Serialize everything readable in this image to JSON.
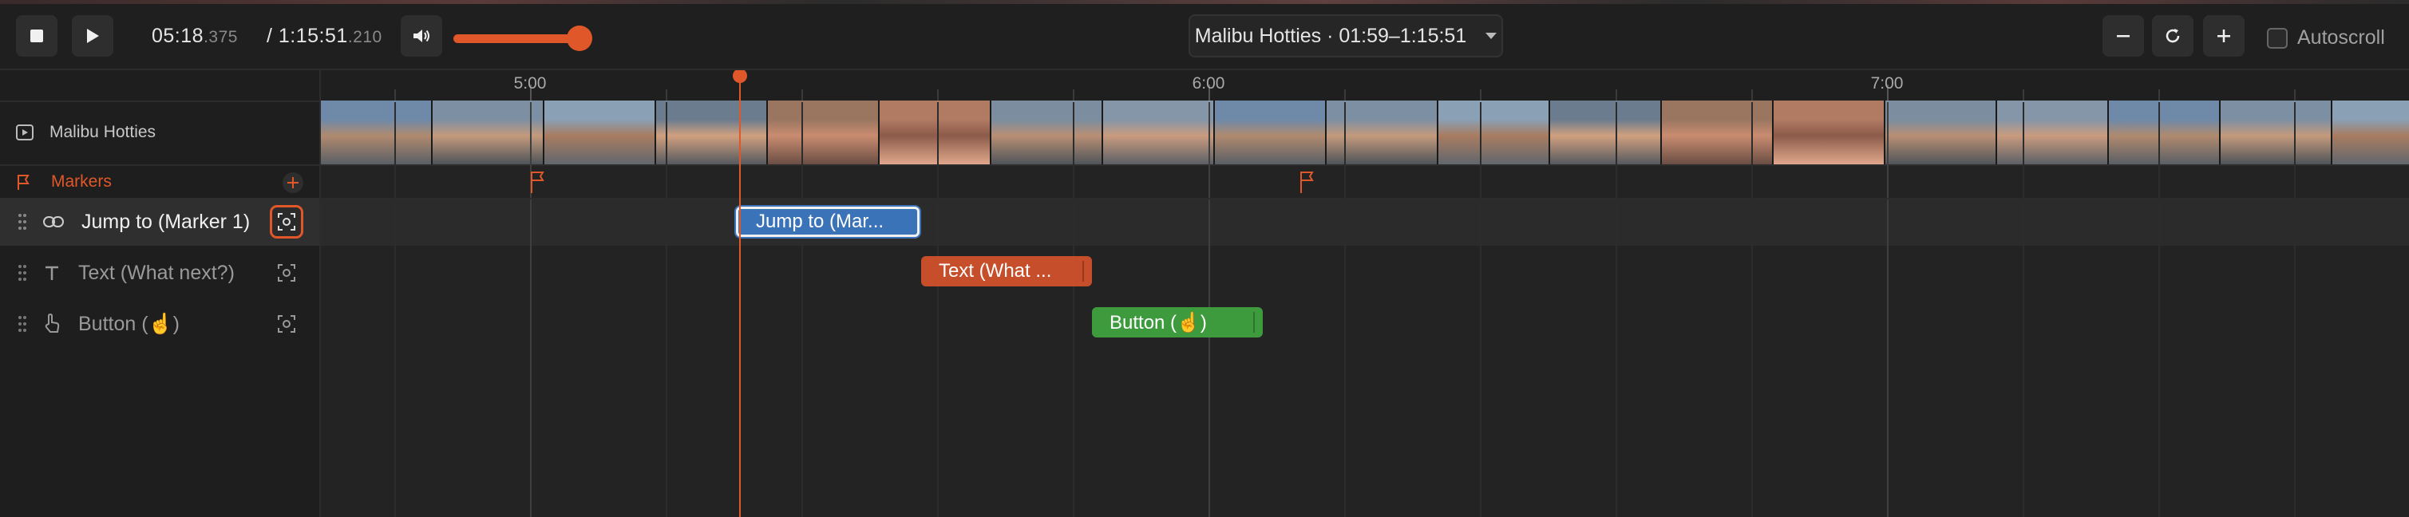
{
  "toolbar": {
    "current_time": "05:18",
    "current_time_ms": ".375",
    "total_time": "/ 1:15:51",
    "total_time_ms": ".210",
    "volume_level": 0.85,
    "title_selector": "Malibu Hotties · 01:59–1:15:51",
    "autoscroll_label": "Autoscroll",
    "autoscroll_checked": false
  },
  "left": {
    "video_track_label": "Malibu Hotties",
    "markers_label": "Markers",
    "tracks": [
      {
        "label": "Jump to (Marker 1)",
        "icon": "link-icon",
        "selected": true
      },
      {
        "label": "Text (What next?)",
        "icon": "text-icon",
        "selected": false
      },
      {
        "label": "Button (☝)",
        "icon": "pointer-hand-icon",
        "selected": false
      }
    ]
  },
  "ruler": {
    "labels": [
      "5:00",
      "6:00",
      "7:00"
    ]
  },
  "clips": [
    {
      "label": "Jump to (Mar...",
      "type": "link"
    },
    {
      "label": "Text (What ...",
      "type": "text"
    },
    {
      "label": "Button (☝)",
      "type": "button"
    }
  ],
  "colors": {
    "accent": "#e0572a",
    "link_clip": "#3b73b9",
    "text_clip": "#c74e2a",
    "button_clip": "#3d9a3d"
  }
}
